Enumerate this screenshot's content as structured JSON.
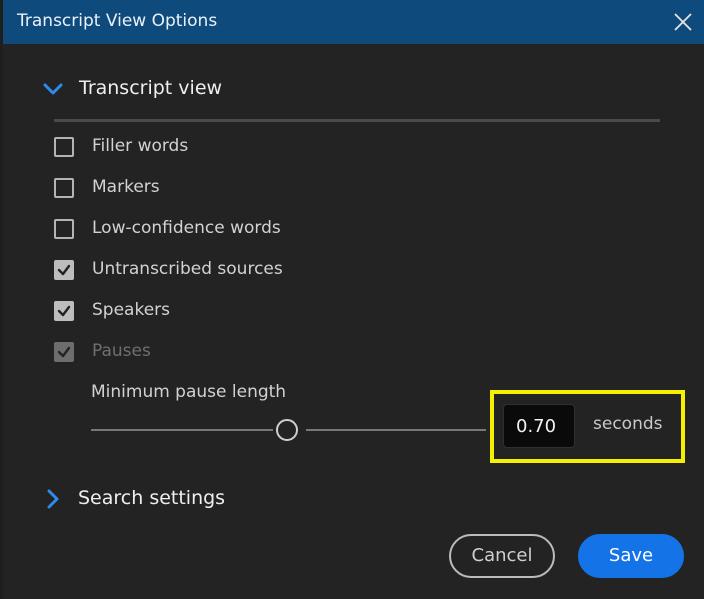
{
  "window": {
    "title": "Transcript View Options"
  },
  "transcript_section": {
    "label": "Transcript view",
    "expanded": true,
    "options": [
      {
        "label": "Filler words",
        "checked": false,
        "disabled": false
      },
      {
        "label": "Markers",
        "checked": false,
        "disabled": false
      },
      {
        "label": "Low-confidence words",
        "checked": false,
        "disabled": false
      },
      {
        "label": "Untranscribed sources",
        "checked": true,
        "disabled": false
      },
      {
        "label": "Speakers",
        "checked": true,
        "disabled": false
      },
      {
        "label": "Pauses",
        "checked": true,
        "disabled": true
      }
    ],
    "min_pause": {
      "label": "Minimum pause length",
      "value": "0.70",
      "unit": "seconds",
      "slider_fraction": 0.48
    }
  },
  "search_section": {
    "label": "Search settings",
    "expanded": false
  },
  "buttons": {
    "cancel": "Cancel",
    "save": "Save"
  },
  "colors": {
    "titlebar": "#0f4a7d",
    "accent": "#1473e6",
    "highlight": "#f5f000",
    "background": "#232323"
  },
  "icons": {
    "close": "close-icon",
    "expand": "chevron-down-icon",
    "collapse": "chevron-right-icon",
    "check": "checkmark-icon"
  }
}
